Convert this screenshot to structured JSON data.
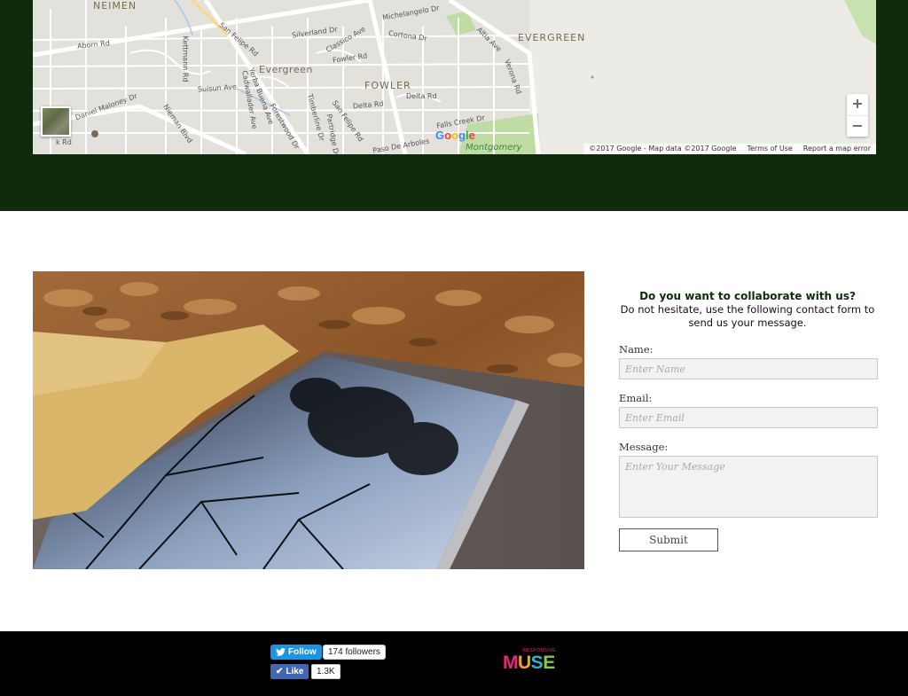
{
  "map": {
    "labels": {
      "neimen": "NEIMEN",
      "evergreen_caps": "EVERGREEN",
      "evergreen": "Evergreen",
      "fowler": "FOWLER",
      "montgomery": "Montgomery",
      "abornrd": "Aborn Rd",
      "sanfelipe1": "San Felipe Rd",
      "silverland": "Silverland Dr",
      "classico": "Classico Ave",
      "michelangelo": "Michelangelo Dr",
      "cortona": "Cortona Dr",
      "altiaave": "Altia Ave",
      "fowlerrd": "Fowler Rd",
      "suisun": "Suisun Ave",
      "deltard": "Delta Rd",
      "deltard2": "Delta Rd",
      "verona": "Verona Rd",
      "kettmann": "Kettmann Rd",
      "daniel": "Daniel Maloney Dr",
      "nieman": "Nieman Blvd",
      "cadwallader": "Cadwallader Ave",
      "yerba": "Yerba Buena Ave",
      "forestwood": "Forestwood Dr",
      "timberline": "Timberline Dr",
      "partridge": "Partridge Dr",
      "sanfelipe2": "San Felipe Rd",
      "fallscreek": "Falls Creek Dr",
      "pasoarboles": "Paso De Arboles",
      "krd": "k Rd"
    },
    "zoom_in": "+",
    "zoom_out": "−",
    "google_logo": [
      "G",
      "o",
      "o",
      "g",
      "l",
      "e"
    ],
    "google_logo_colors": [
      "#4285f4",
      "#ea4335",
      "#fbbc05",
      "#4285f4",
      "#34a853",
      "#ea4335"
    ],
    "attribution": "©2017 Google - Map data ©2017 Google",
    "terms": "Terms of Use",
    "report": "Report a map error"
  },
  "contact": {
    "heading": "Do you want to collaborate with us?",
    "subtext": "Do not hesitate, use the following contact form to send us your message.",
    "name_label": "Name:",
    "name_placeholder": "Enter Name",
    "email_label": "Email:",
    "email_placeholder": "Enter Email",
    "message_label": "Message:",
    "message_placeholder": "Enter Your Message",
    "submit_label": "Submit"
  },
  "footer": {
    "twitter_label": "Follow",
    "twitter_count": "174 followers",
    "facebook_label": "Like",
    "facebook_count": "1.3K",
    "brand_small": "RESPONSIVE",
    "brand_letters": [
      "M",
      "U",
      "S",
      "E"
    ]
  },
  "colors": {
    "band": "#0f2b0c",
    "footer": "#000000",
    "twitter": "#1b95e0",
    "facebook": "#4267b2"
  }
}
